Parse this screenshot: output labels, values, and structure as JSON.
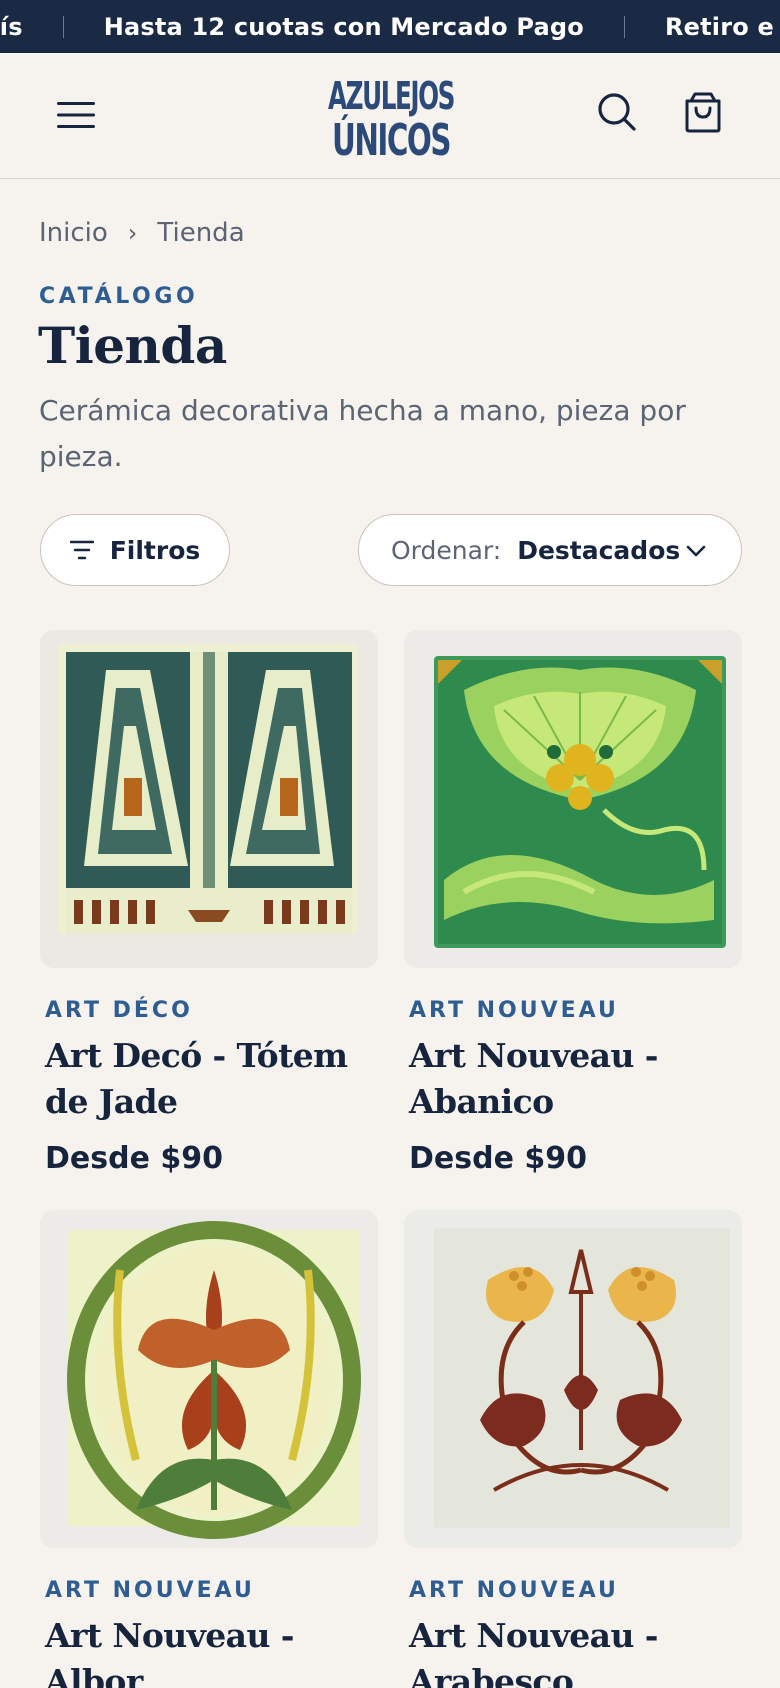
{
  "announcement": {
    "items": [
      "país",
      "Hasta 12 cuotas con Mercado Pago",
      "Retiro e"
    ]
  },
  "header": {
    "logo_line1": "AZULEJOS",
    "logo_line2": "ÚNICOS",
    "icons": [
      "menu-icon",
      "search-icon",
      "bag-icon"
    ]
  },
  "breadcrumb": {
    "items": [
      "Inicio",
      "Tienda"
    ],
    "separator": "›"
  },
  "page": {
    "eyebrow": "CATÁLOGO",
    "title": "Tienda",
    "subtitle": "Cerámica decorativa hecha a mano, pieza por pieza."
  },
  "controls": {
    "filter_label": "Filtros",
    "sort_label": "Ordenar:",
    "sort_value": "Destacados"
  },
  "products": [
    {
      "category": "ART DÉCO",
      "title": "Art Decó - Tótem de Jade",
      "price": "Desde $90"
    },
    {
      "category": "ART NOUVEAU",
      "title": "Art Nouveau - Abanico",
      "price": "Desde $90"
    },
    {
      "category": "ART NOUVEAU",
      "title": "Art Nouveau - Albor",
      "price": ""
    },
    {
      "category": "ART NOUVEAU",
      "title": "Art Nouveau - Arabesco",
      "price": ""
    }
  ],
  "colors": {
    "navy": "#1b2a44",
    "accent_blue": "#2f5d92",
    "background": "#f6f3ee",
    "text": "#16243d",
    "muted": "#5b6474"
  }
}
